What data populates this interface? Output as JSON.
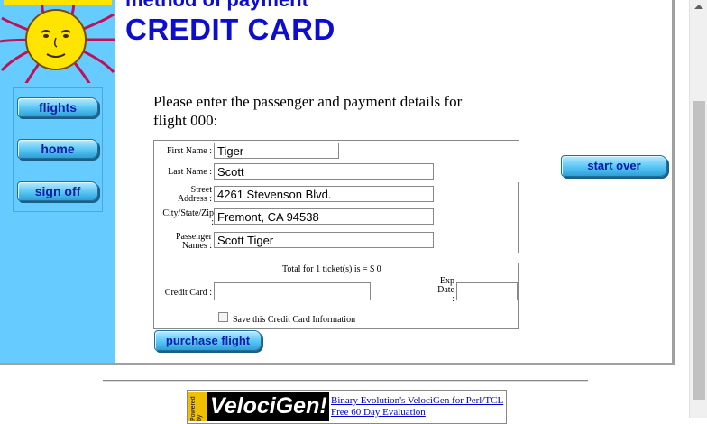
{
  "header": {
    "subtitle": "method of payment",
    "title": "CREDIT CARD"
  },
  "sidebar": {
    "nav": [
      {
        "label": "flights"
      },
      {
        "label": "home"
      },
      {
        "label": "sign off"
      }
    ]
  },
  "main": {
    "instructions": "Please enter the passenger and payment details for flight 000:",
    "form": {
      "first_name": {
        "label": "First Name :",
        "value": "Tiger"
      },
      "last_name": {
        "label": "Last Name :",
        "value": "Scott"
      },
      "street": {
        "label_1": "Street",
        "label_2": "Address :",
        "value": "4261 Stevenson Blvd."
      },
      "city": {
        "label_1": "City/State/Zip",
        "label_2": ":",
        "value": "Fremont, CA 94538"
      },
      "passenger": {
        "label_1": "Passenger",
        "label_2": "Names :",
        "value": "Scott Tiger"
      },
      "total": "Total for 1 ticket(s) is = $ 0",
      "credit_card": {
        "label": "Credit Card :",
        "value": ""
      },
      "exp_date": {
        "label_1": "Exp",
        "label_2": "Date",
        "label_3": ":",
        "value": ""
      },
      "save_card": {
        "label": "Save this Credit Card Information",
        "checked": false
      }
    },
    "purchase_label": "purchase flight",
    "start_over_label": "start over"
  },
  "footer": {
    "powered_by": "Powered by",
    "logo_text": "VelociGen!",
    "link_1": "Binary Evolution's VelociGen for Perl/TCL",
    "link_2": "Free 60 Day Evaluation"
  },
  "colors": {
    "sidebar_bg": "#66ccff",
    "title_blue": "#0d0dd0",
    "button_blue": "#58c6f4"
  }
}
